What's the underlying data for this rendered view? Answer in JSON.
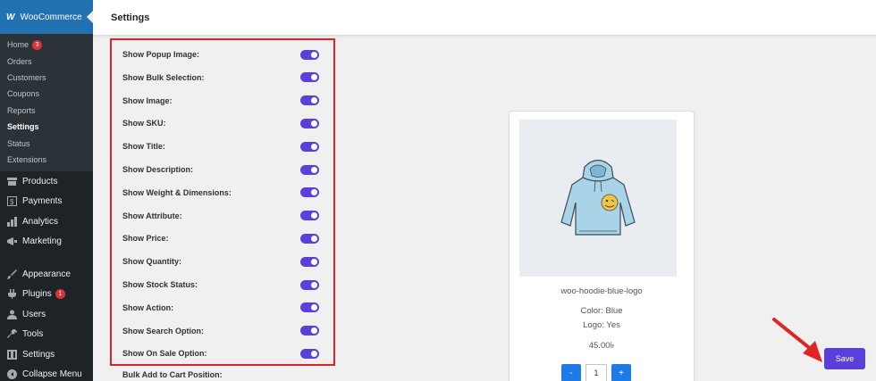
{
  "sidebar": {
    "brand": "WooCommerce",
    "brand_logo": "W",
    "submenu": [
      {
        "label": "Home",
        "badge": "3"
      },
      {
        "label": "Orders"
      },
      {
        "label": "Customers"
      },
      {
        "label": "Coupons"
      },
      {
        "label": "Reports"
      },
      {
        "label": "Settings",
        "current": true
      },
      {
        "label": "Status"
      },
      {
        "label": "Extensions"
      }
    ],
    "menu": [
      {
        "label": "Products",
        "icon": "archive-icon"
      },
      {
        "label": "Payments",
        "icon": "dollar-icon"
      },
      {
        "label": "Analytics",
        "icon": "bar-chart-icon"
      },
      {
        "label": "Marketing",
        "icon": "megaphone-icon"
      },
      {
        "label": "Appearance",
        "icon": "paintbrush-icon"
      },
      {
        "label": "Plugins",
        "icon": "plug-icon",
        "badge": "1"
      },
      {
        "label": "Users",
        "icon": "users-icon"
      },
      {
        "label": "Tools",
        "icon": "wrench-icon"
      },
      {
        "label": "Settings",
        "icon": "settings-icon"
      },
      {
        "label": "Collapse Menu",
        "icon": "collapse-icon"
      }
    ]
  },
  "header": {
    "title": "Settings"
  },
  "settings": {
    "options": [
      {
        "label": "Show Popup Image:",
        "enabled": true
      },
      {
        "label": "Show Bulk Selection:",
        "enabled": true
      },
      {
        "label": "Show Image:",
        "enabled": true
      },
      {
        "label": "Show SKU:",
        "enabled": true
      },
      {
        "label": "Show Title:",
        "enabled": true
      },
      {
        "label": "Show Description:",
        "enabled": true
      },
      {
        "label": "Show Weight & Dimensions:",
        "enabled": true
      },
      {
        "label": "Show Attribute:",
        "enabled": true
      },
      {
        "label": "Show Price:",
        "enabled": true
      },
      {
        "label": "Show Quantity:",
        "enabled": true
      },
      {
        "label": "Show Stock Status:",
        "enabled": true
      },
      {
        "label": "Show Action:",
        "enabled": true
      },
      {
        "label": "Show Search Option:",
        "enabled": true
      },
      {
        "label": "Show On Sale Option:",
        "enabled": true
      }
    ],
    "bulk_position_label": "Bulk Add to Cart Position:"
  },
  "product": {
    "name": "woo-hoodie-blue-logo",
    "color": "Color: Blue",
    "logo": "Logo: Yes",
    "price": "45.00৳",
    "quantity": "1",
    "minus_label": "-",
    "plus_label": "+"
  },
  "actions": {
    "save_label": "Save"
  },
  "colors": {
    "accent": "#5b3fd9",
    "highlight": "#e02424",
    "qty_button": "#1e7be6",
    "sidebar": "#1d2327",
    "active_menu": "#2271b1"
  }
}
